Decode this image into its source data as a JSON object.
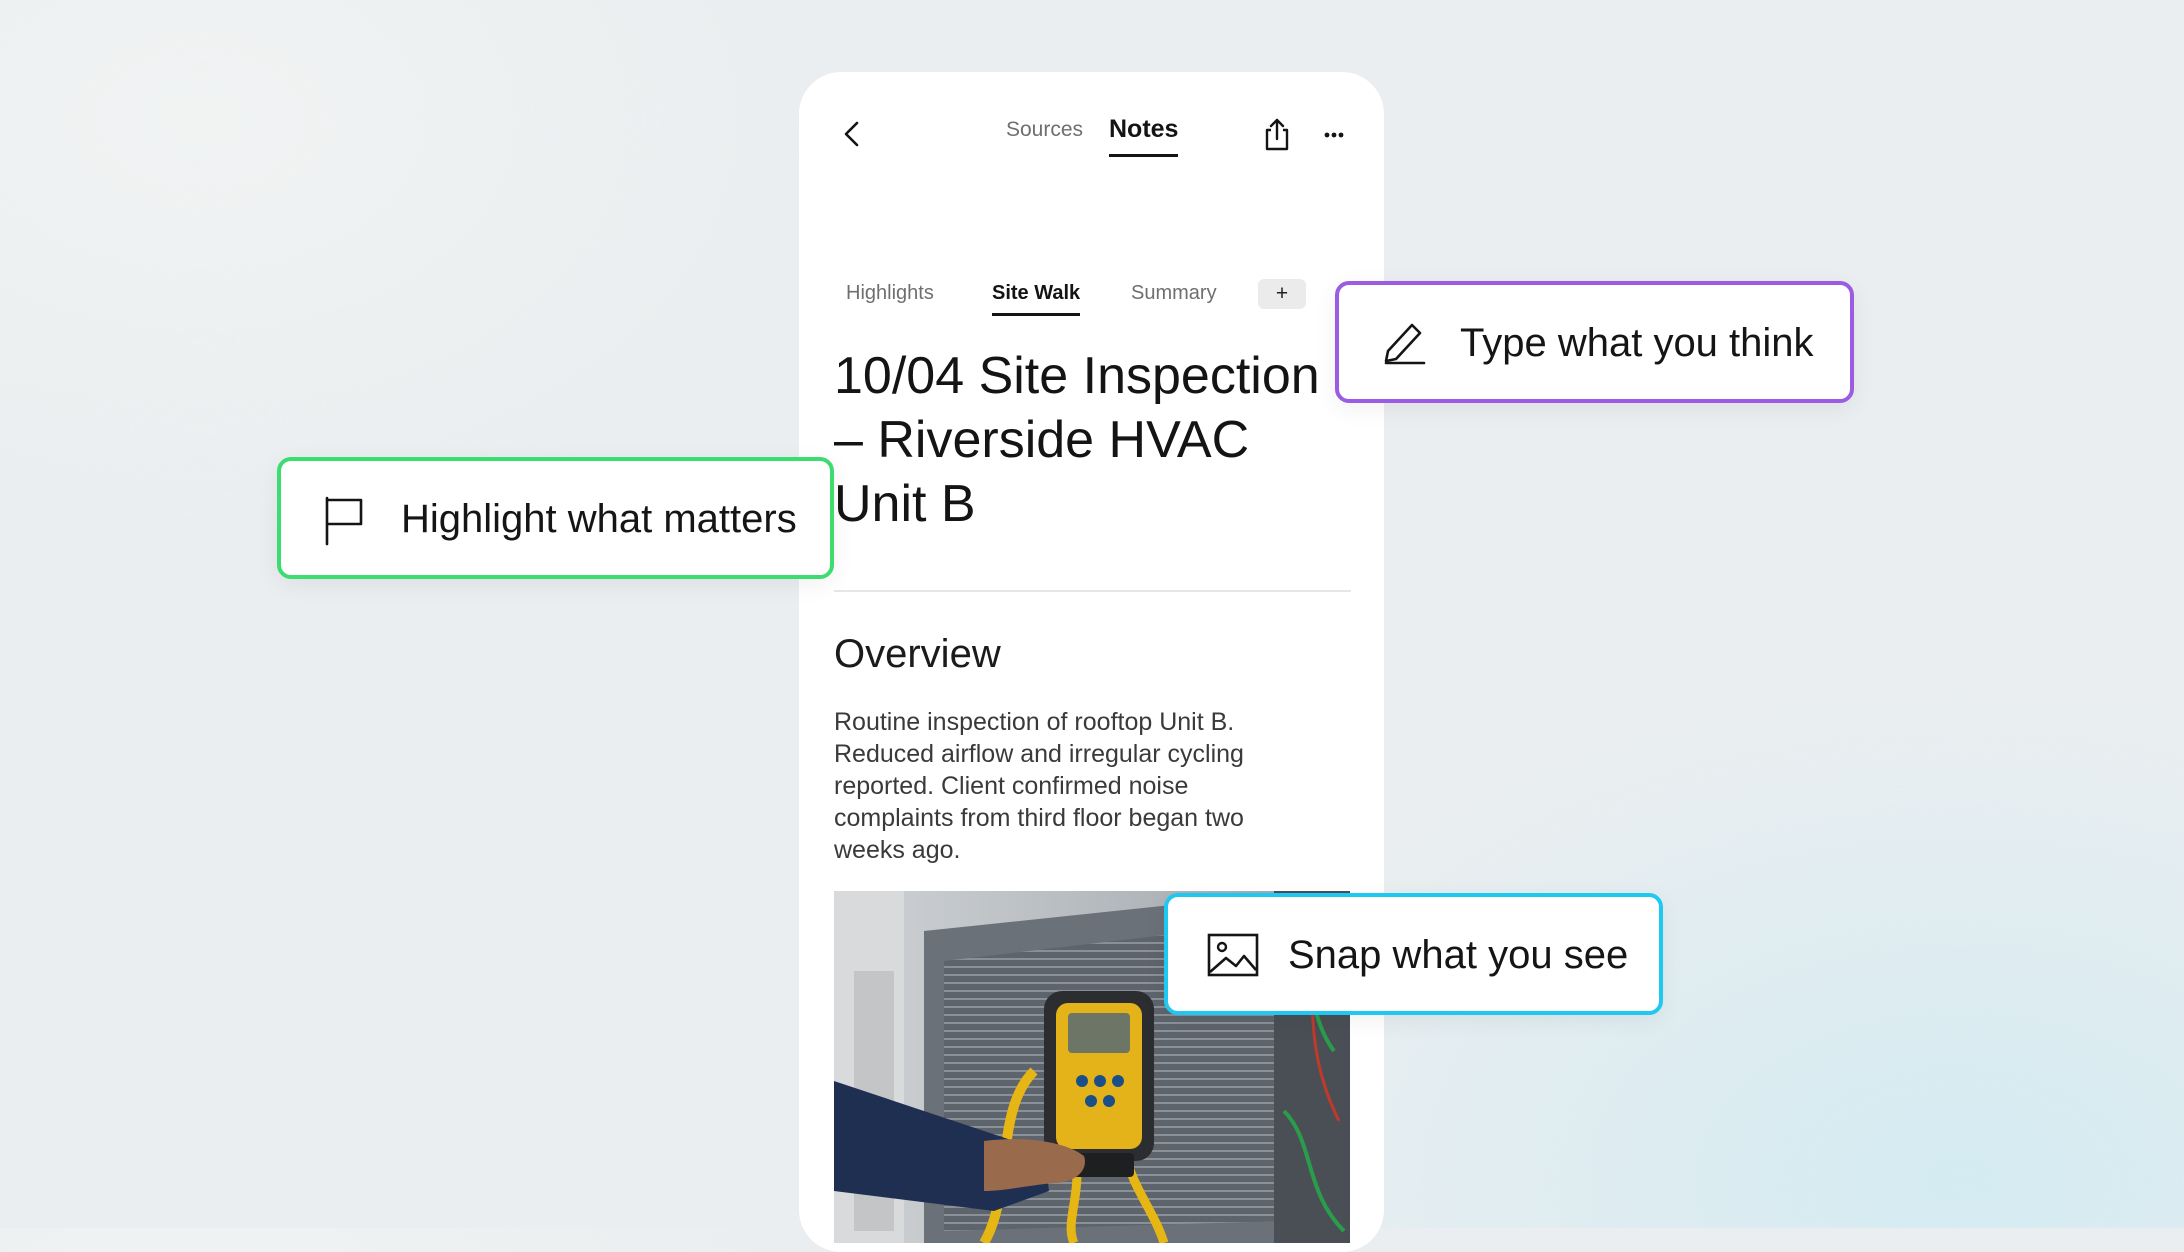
{
  "header": {
    "tabs": [
      {
        "label": "Sources",
        "active": false
      },
      {
        "label": "Notes",
        "active": true
      }
    ],
    "icons": {
      "back": "chevron-left-icon",
      "share": "share-icon",
      "more": "more-horizontal-icon"
    }
  },
  "subtabs": {
    "items": [
      {
        "label": "Highlights",
        "active": false
      },
      {
        "label": "Site Walk",
        "active": true
      },
      {
        "label": "Summary",
        "active": false
      }
    ],
    "add_label": "+"
  },
  "note": {
    "title": "10/04 Site Inspection\n– Riverside HVAC\nUnit B",
    "section_heading": "Overview",
    "body": "Routine inspection of rooftop Unit B.\nReduced  airflow and irregular cycling\nreported. Client  confirmed noise\ncomplaints from third floor  began two\nweeks ago.",
    "photo": "photo-of-technician-using-manifold-gauge-on-hvac-unit"
  },
  "callouts": {
    "type": {
      "label": "Type what you think",
      "icon": "pencil-icon",
      "color": "#9b5be3"
    },
    "highlight": {
      "label": "Highlight what matters",
      "icon": "flag-icon",
      "color": "#3ddc70"
    },
    "snap": {
      "label": "Snap what you see",
      "icon": "image-icon",
      "color": "#1fc8f0"
    }
  },
  "colors": {
    "background": "#eaeef0",
    "card": "#ffffff",
    "text_primary": "#141414",
    "text_secondary": "#6f6f6f"
  }
}
